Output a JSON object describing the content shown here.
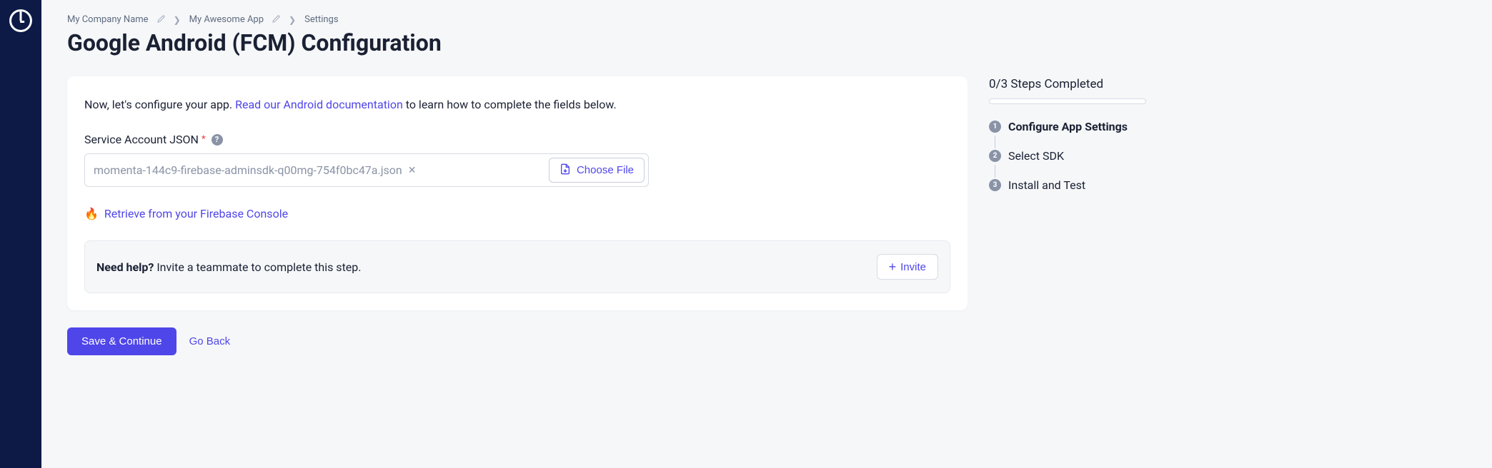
{
  "breadcrumb": {
    "company": "My Company Name",
    "app": "My Awesome App",
    "page": "Settings"
  },
  "title": "Google Android (FCM) Configuration",
  "intro": {
    "prefix": "Now, let's configure your app. ",
    "link": "Read our Android documentation",
    "suffix": " to learn how to complete the fields below."
  },
  "field": {
    "label": "Service Account JSON",
    "filename": "momenta-144c9-firebase-adminsdk-q00mg-754f0bc47a.json",
    "chooseButton": "Choose File"
  },
  "retrieve": {
    "emoji": "🔥",
    "link": "Retrieve from your Firebase Console"
  },
  "helpBox": {
    "strong": "Need help?",
    "text": " Invite a teammate to complete this step.",
    "button": "Invite"
  },
  "actions": {
    "save": "Save & Continue",
    "back": "Go Back"
  },
  "steps": {
    "header": "0/3 Steps Completed",
    "items": [
      {
        "num": "1",
        "label": "Configure App Settings"
      },
      {
        "num": "2",
        "label": "Select SDK"
      },
      {
        "num": "3",
        "label": "Install and Test"
      }
    ]
  }
}
